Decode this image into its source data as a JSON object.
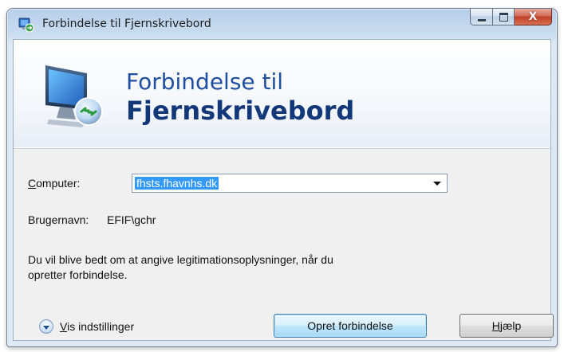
{
  "window": {
    "title": "Forbindelse til Fjernskrivebord",
    "icon": "remote-desktop-icon",
    "caption_buttons": {
      "minimize_glyph": "minimize-icon",
      "maximize_glyph": "maximize-icon",
      "close_glyph": "X"
    }
  },
  "banner": {
    "line1": "Forbindelse til",
    "line2": "Fjernskrivebord",
    "icon": "remote-desktop-monitor-icon"
  },
  "form": {
    "computer_label_accel": "C",
    "computer_label_rest": "omputer:",
    "computer_value": "fhsts.fhavnhs.dk",
    "username_label": "Brugernavn:",
    "username_value": "EFIF\\gchr",
    "info_text_line1": "Du vil blive bedt om at angive legitimationsoplysninger, når du",
    "info_text_line2": "opretter forbindelse."
  },
  "footer": {
    "options_accel": "V",
    "options_rest": "is indstillinger",
    "connect_label": "Opret forbindelse",
    "help_accel": "H",
    "help_rest": "jælp"
  },
  "colors": {
    "title_blue": "#1f4fa0",
    "selection": "#3399ff",
    "close_red": "#c2402a"
  }
}
